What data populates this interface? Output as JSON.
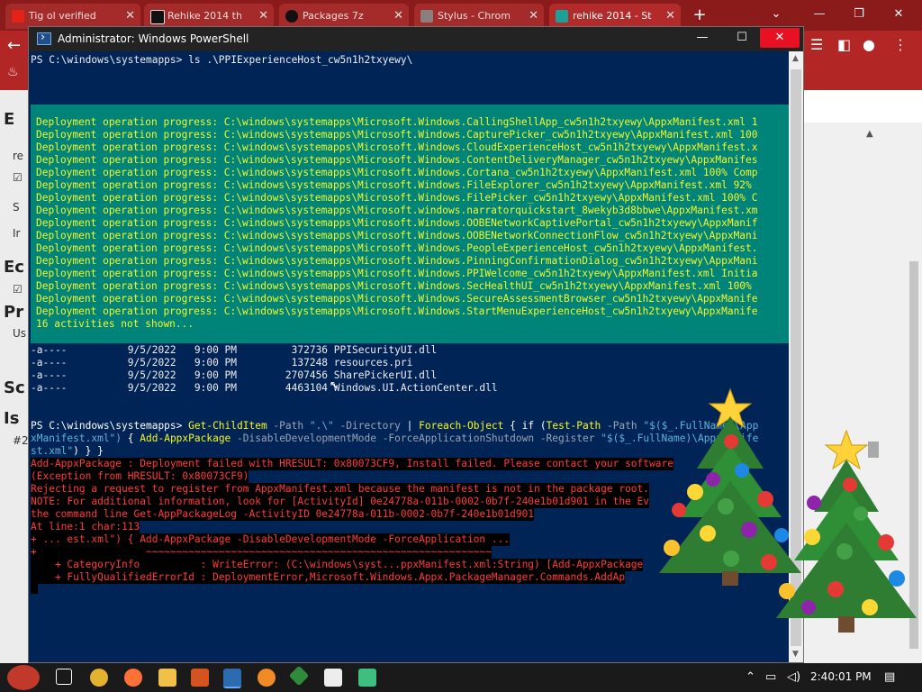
{
  "browser": {
    "tabs": [
      {
        "label": "Tig ol verified",
        "color": "#e62117"
      },
      {
        "label": "Rehike 2014 th",
        "color": "#111111"
      },
      {
        "label": "Packages 7z",
        "color": "#111111"
      },
      {
        "label": "Stylus - Chrom",
        "color": "#8a7f7f"
      },
      {
        "label": "rehike 2014 - St",
        "color": "#1aa29a"
      }
    ],
    "new_tab": "+",
    "window_controls": {
      "minimize": "—",
      "maximize": "❐",
      "close": "✕"
    }
  },
  "page_fragments": [
    "E",
    "re",
    "S",
    "Ir",
    "Ec",
    "Pr",
    "Us",
    "Sc",
    "Is",
    "#2"
  ],
  "powershell": {
    "title": "Administrator: Windows PowerShell",
    "controls": {
      "minimize": "—",
      "maximize": "☐",
      "close": "✕"
    },
    "prompt1": "PS C:\\windows\\systemapps> ls .\\PPIExperienceHost_cw5n1h2txyewy\\",
    "progress_lines": [
      "Deployment operation progress: C:\\windows\\systemapps\\Microsoft.Windows.CallingShellApp_cw5n1h2txyewy\\AppxManifest.xml 1",
      "Deployment operation progress: C:\\windows\\systemapps\\Microsoft.Windows.CapturePicker_cw5n1h2txyewy\\AppxManifest.xml 100",
      "Deployment operation progress: C:\\windows\\systemapps\\Microsoft.Windows.CloudExperienceHost_cw5n1h2txyewy\\AppxManifest.x",
      "Deployment operation progress: C:\\windows\\systemapps\\Microsoft.Windows.ContentDeliveryManager_cw5n1h2txyewy\\AppxManifes",
      "Deployment operation progress: C:\\windows\\systemapps\\Microsoft.Windows.Cortana_cw5n1h2txyewy\\AppxManifest.xml 100% Comp",
      "Deployment operation progress: C:\\windows\\systemapps\\Microsoft.Windows.FileExplorer_cw5n1h2txyewy\\AppxManifest.xml 92% ",
      "Deployment operation progress: C:\\windows\\systemapps\\Microsoft.Windows.FilePicker_cw5n1h2txyewy\\AppxManifest.xml 100% C",
      "Deployment operation progress: C:\\windows\\systemapps\\Microsoft.windows.narratorquickstart_8wekyb3d8bbwe\\AppxManifest.xm",
      "Deployment operation progress: C:\\windows\\systemapps\\Microsoft.Windows.OOBENetworkCaptivePortal_cw5n1h2txyewy\\AppxManif",
      "Deployment operation progress: C:\\windows\\systemapps\\Microsoft.Windows.OOBENetworkConnectionFlow_cw5n1h2txyewy\\AppxMani",
      "Deployment operation progress: C:\\windows\\systemapps\\Microsoft.Windows.PeopleExperienceHost_cw5n1h2txyewy\\AppxManifest.",
      "Deployment operation progress: C:\\windows\\systemapps\\Microsoft.Windows.PinningConfirmationDialog_cw5n1h2txyewy\\AppxMani",
      "Deployment operation progress: C:\\windows\\systemapps\\Microsoft.Windows.PPIWelcome_cw5n1h2txyewy\\AppxManifest.xml Initia",
      "Deployment operation progress: C:\\windows\\systemapps\\Microsoft.Windows.SecHealthUI_cw5n1h2txyewy\\AppxManifest.xml 100% ",
      "Deployment operation progress: C:\\windows\\systemapps\\Microsoft.Windows.SecureAssessmentBrowser_cw5n1h2txyewy\\AppxManife",
      "Deployment operation progress: C:\\windows\\systemapps\\Microsoft.Windows.StartMenuExperienceHost_cw5n1h2txyewy\\AppxManife",
      "16 activities not shown..."
    ],
    "listing": [
      "-a----          9/5/2022   9:00 PM         372736 PPISecurityUI.dll",
      "-a----          9/5/2022   9:00 PM         137248 resources.pri",
      "-a----          9/5/2022   9:00 PM        2707456 SharePickerUI.dll",
      "-a----          9/5/2022   9:00 PM        4463104 Windows.UI.ActionCenter.dll"
    ],
    "cmd": {
      "prompt": "PS C:\\windows\\systemapps> ",
      "p1": "Get-ChildItem",
      "p2": " -Path ",
      "p3": "\".\\\"",
      "p4": " -Directory ",
      "p5": "| ",
      "p6": "Foreach-Object",
      "p7": " { ",
      "p8": "if",
      "p9": " (",
      "p10": "Test-Path",
      "p11": " -Path ",
      "p12": "\"$($_.FullName)\\App",
      "p13": "xManifest.xml\")",
      "p14": " { ",
      "p15": "Add-AppxPackage",
      "p16": " -DisableDevelopmentMode -ForceApplicationShutdown -Register ",
      "p17": "\"$($_.FullName)\\AppxManife",
      "p18": "st.xml\"",
      "p19": ") } }"
    },
    "error_lines": [
      "Add-AppxPackage : Deployment failed with HRESULT: 0x80073CF9, Install failed. Please contact your software",
      "(Exception from HRESULT: 0x80073CF9)",
      "Rejecting a request to register from AppxManifest.xml because the manifest is not in the package root.",
      "NOTE: For additional information, look for [ActivityId] 0e24778a-011b-0002-0b7f-240e1b01d901 in the Ev",
      "the command line Get-AppPackageLog -ActivityID 0e24778a-011b-0002-0b7f-240e1b01d901",
      "At line:1 char:113",
      "+ ... est.xml\") { Add-AppxPackage -DisableDevelopmentMode -ForceApplication ...",
      "+                  ~~~~~~~~~~~~~~~~~~~~~~~~~~~~~~~~~~~~~~~~~~~~~~~~~~~~~~~~~",
      "    + CategoryInfo          : WriteError: (C:\\windows\\syst...ppxManifest.xml:String) [Add-AppxPackage",
      "    + FullyQualifiedErrorId : DeploymentError,Microsoft.Windows.Appx.PackageManager.Commands.AddAp"
    ]
  },
  "taskbar": {
    "clock": "2:40:01 PM",
    "icons": [
      "task-view",
      "chrome",
      "firefox",
      "file-explorer",
      "app-7zip-red",
      "powershell",
      "search-orange",
      "green-app",
      "7zip",
      "notepad-green"
    ]
  }
}
